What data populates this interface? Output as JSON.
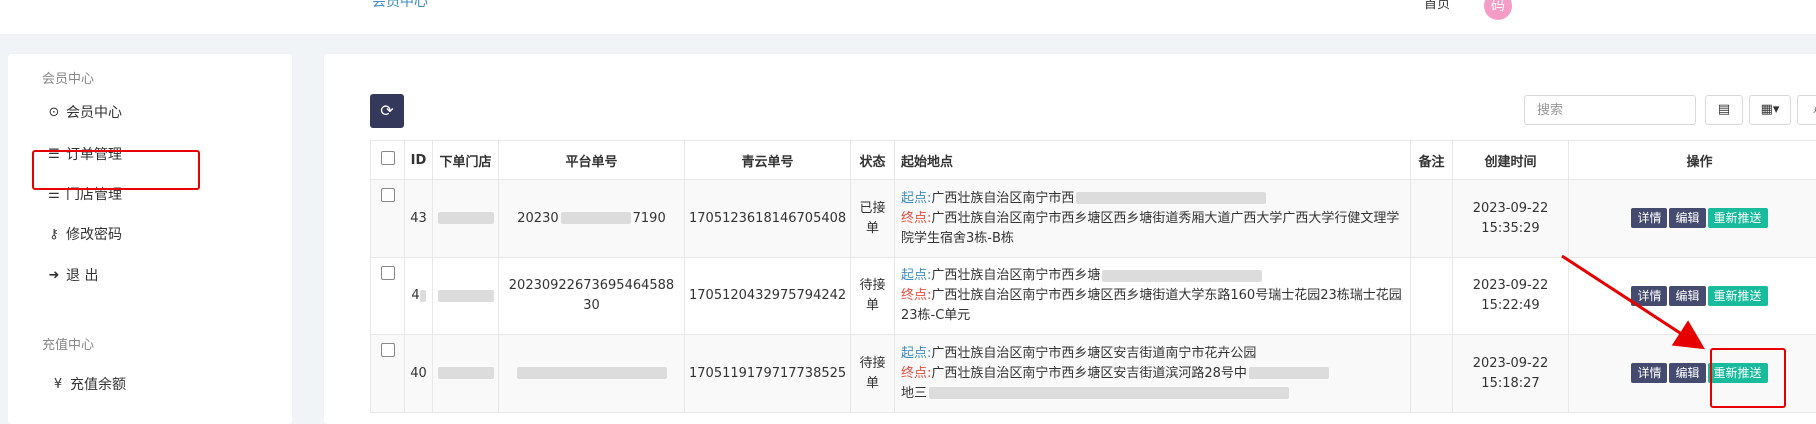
{
  "topbar": {
    "link": "会员中心",
    "home": "首页",
    "avatar_char": "码"
  },
  "sidebar": {
    "section1": "会员中心",
    "items": [
      {
        "icon": "user-circle-icon",
        "glyph": "⊙",
        "label": "会员中心"
      },
      {
        "icon": "list-icon",
        "glyph": "☰",
        "label": "订单管理",
        "active": true
      },
      {
        "icon": "list-icon",
        "glyph": "☰",
        "label": "门店管理"
      },
      {
        "icon": "key-icon",
        "glyph": "⚷",
        "label": "修改密码"
      },
      {
        "icon": "sign-out-icon",
        "glyph": "➜",
        "label": "退 出"
      }
    ],
    "section2": "充值中心",
    "items2": [
      {
        "icon": "yen-icon",
        "glyph": "¥",
        "label": "充值余额"
      }
    ]
  },
  "toolbar": {
    "search_placeholder": "搜索",
    "refresh_icon": "refresh-icon"
  },
  "table": {
    "headers": [
      "",
      "ID",
      "下单门店",
      "平台单号",
      "青云单号",
      "状态",
      "起始地点",
      "备注",
      "创建时间",
      "操作"
    ],
    "start_label": "起点:",
    "end_label": "终点:",
    "rows": [
      {
        "id": "43",
        "platform_no": "20230",
        "platform_no_tail": "7190",
        "qy_no": "1705123618146705408",
        "status": "已接单",
        "start": "广西壮族自治区南宁市西",
        "end": "广西壮族自治区南宁市西乡塘区西乡塘街道秀厢大道广西大学广西大学行健文理学院学生宿舍3栋-B栋",
        "date": "2023-09-22",
        "time": "15:35:29"
      },
      {
        "id": "4",
        "platform_no": "20230922673695464588 30",
        "platform_no_tail": "",
        "qy_no": "1705120432975794242",
        "status": "待接单",
        "start": "广西壮族自治区南宁市西乡塘",
        "end": "广西壮族自治区南宁市西乡塘区西乡塘街道大学东路160号瑞士花园23栋瑞士花园23栋-C单元",
        "date": "2023-09-22",
        "time": "15:22:49"
      },
      {
        "id": "40",
        "platform_no": "",
        "platform_no_tail": "",
        "qy_no": "1705119179717738525",
        "status": "待接单",
        "start": "广西壮族自治区南宁市西乡塘区安吉街道南宁市花卉公园",
        "end": "广西壮族自治区南宁市西乡塘区安吉街道滨河路28号中",
        "end_cont": "地三",
        "date": "2023-09-22",
        "time": "15:18:27"
      }
    ],
    "ops": {
      "detail": "详情",
      "edit": "编辑",
      "push": "重新推送"
    }
  },
  "colors": {
    "accent": "#34385a",
    "push": "#18bc9c",
    "highlight": "#e60000",
    "link": "#3c8dbc"
  }
}
